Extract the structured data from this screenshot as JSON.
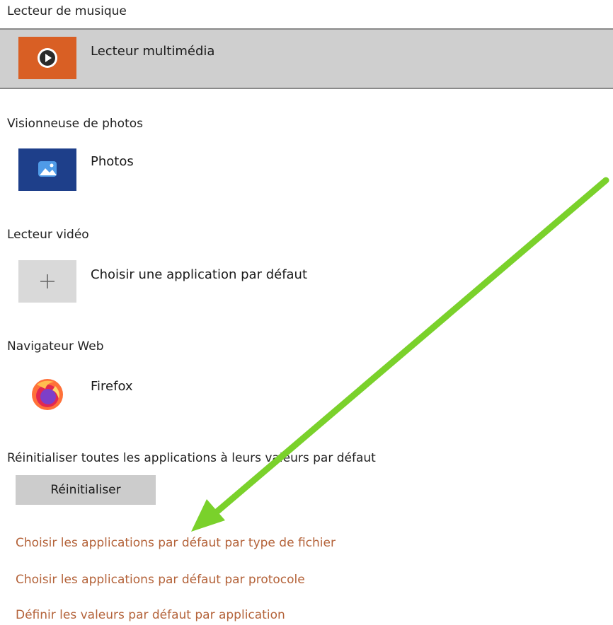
{
  "sections": [
    {
      "label": "Lecteur de musique",
      "app": "Lecteur multimédia",
      "icon": "media-player-icon"
    },
    {
      "label": "Visionneuse de photos",
      "app": "Photos",
      "icon": "photos-icon"
    },
    {
      "label": "Lecteur vidéo",
      "app": "Choisir une application par défaut",
      "icon": "plus-icon"
    },
    {
      "label": "Navigateur Web",
      "app": "Firefox",
      "icon": "firefox-icon"
    }
  ],
  "reset": {
    "label": "Réinitialiser toutes les applications à leurs valeurs par défaut",
    "button": "Réinitialiser"
  },
  "links": [
    "Choisir les applications par défaut par type de fichier",
    "Choisir les applications par défaut par protocole",
    "Définir les valeurs par défaut par application"
  ],
  "colors": {
    "link": "#b4633a",
    "arrow": "#7ad12b",
    "selected_row": "#cfcfcf"
  }
}
